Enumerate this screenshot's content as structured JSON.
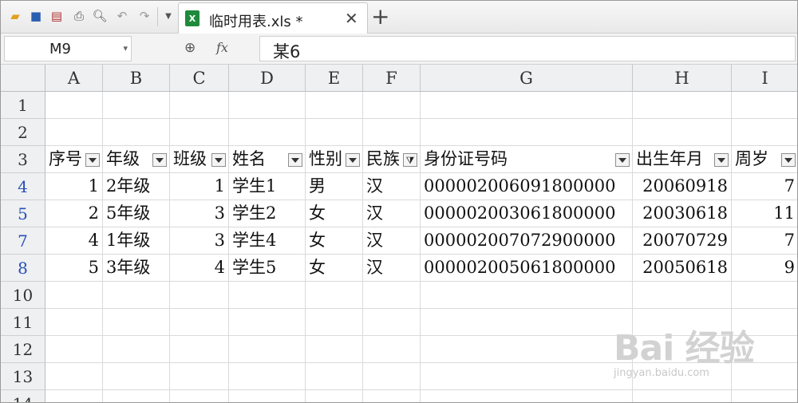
{
  "tab": {
    "title": "临时用表.xls *"
  },
  "formula_bar": {
    "cell_ref": "M9",
    "fx_label": "fx",
    "content": "某6"
  },
  "columns": [
    "A",
    "B",
    "C",
    "D",
    "E",
    "F",
    "G",
    "H",
    "I"
  ],
  "row_headers": [
    "1",
    "2",
    "3",
    "4",
    "5",
    "7",
    "8",
    "10",
    "11",
    "12",
    "13",
    "14"
  ],
  "headers": [
    "序号",
    "年级",
    "班级",
    "姓名",
    "性别",
    "民族",
    "身份证号码",
    "出生年月",
    "周岁"
  ],
  "rows": [
    [
      "1",
      "2年级",
      "1",
      "学生1",
      "男",
      "汉",
      "000002006091800000",
      "20060918",
      "7"
    ],
    [
      "2",
      "5年级",
      "3",
      "学生2",
      "女",
      "汉",
      "000002003061800000",
      "20030618",
      "11"
    ],
    [
      "4",
      "1年级",
      "3",
      "学生4",
      "女",
      "汉",
      "000002007072900000",
      "20070729",
      "7"
    ],
    [
      "5",
      "3年级",
      "4",
      "学生5",
      "女",
      "汉",
      "000002005061800000",
      "20050618",
      "9"
    ]
  ],
  "watermark": {
    "main": "Bai 经验",
    "sub": "jingyan.baidu.com"
  },
  "colors": {
    "filtered_row_header": "#2b4fb8",
    "excel_green": "#1e8a3c"
  }
}
